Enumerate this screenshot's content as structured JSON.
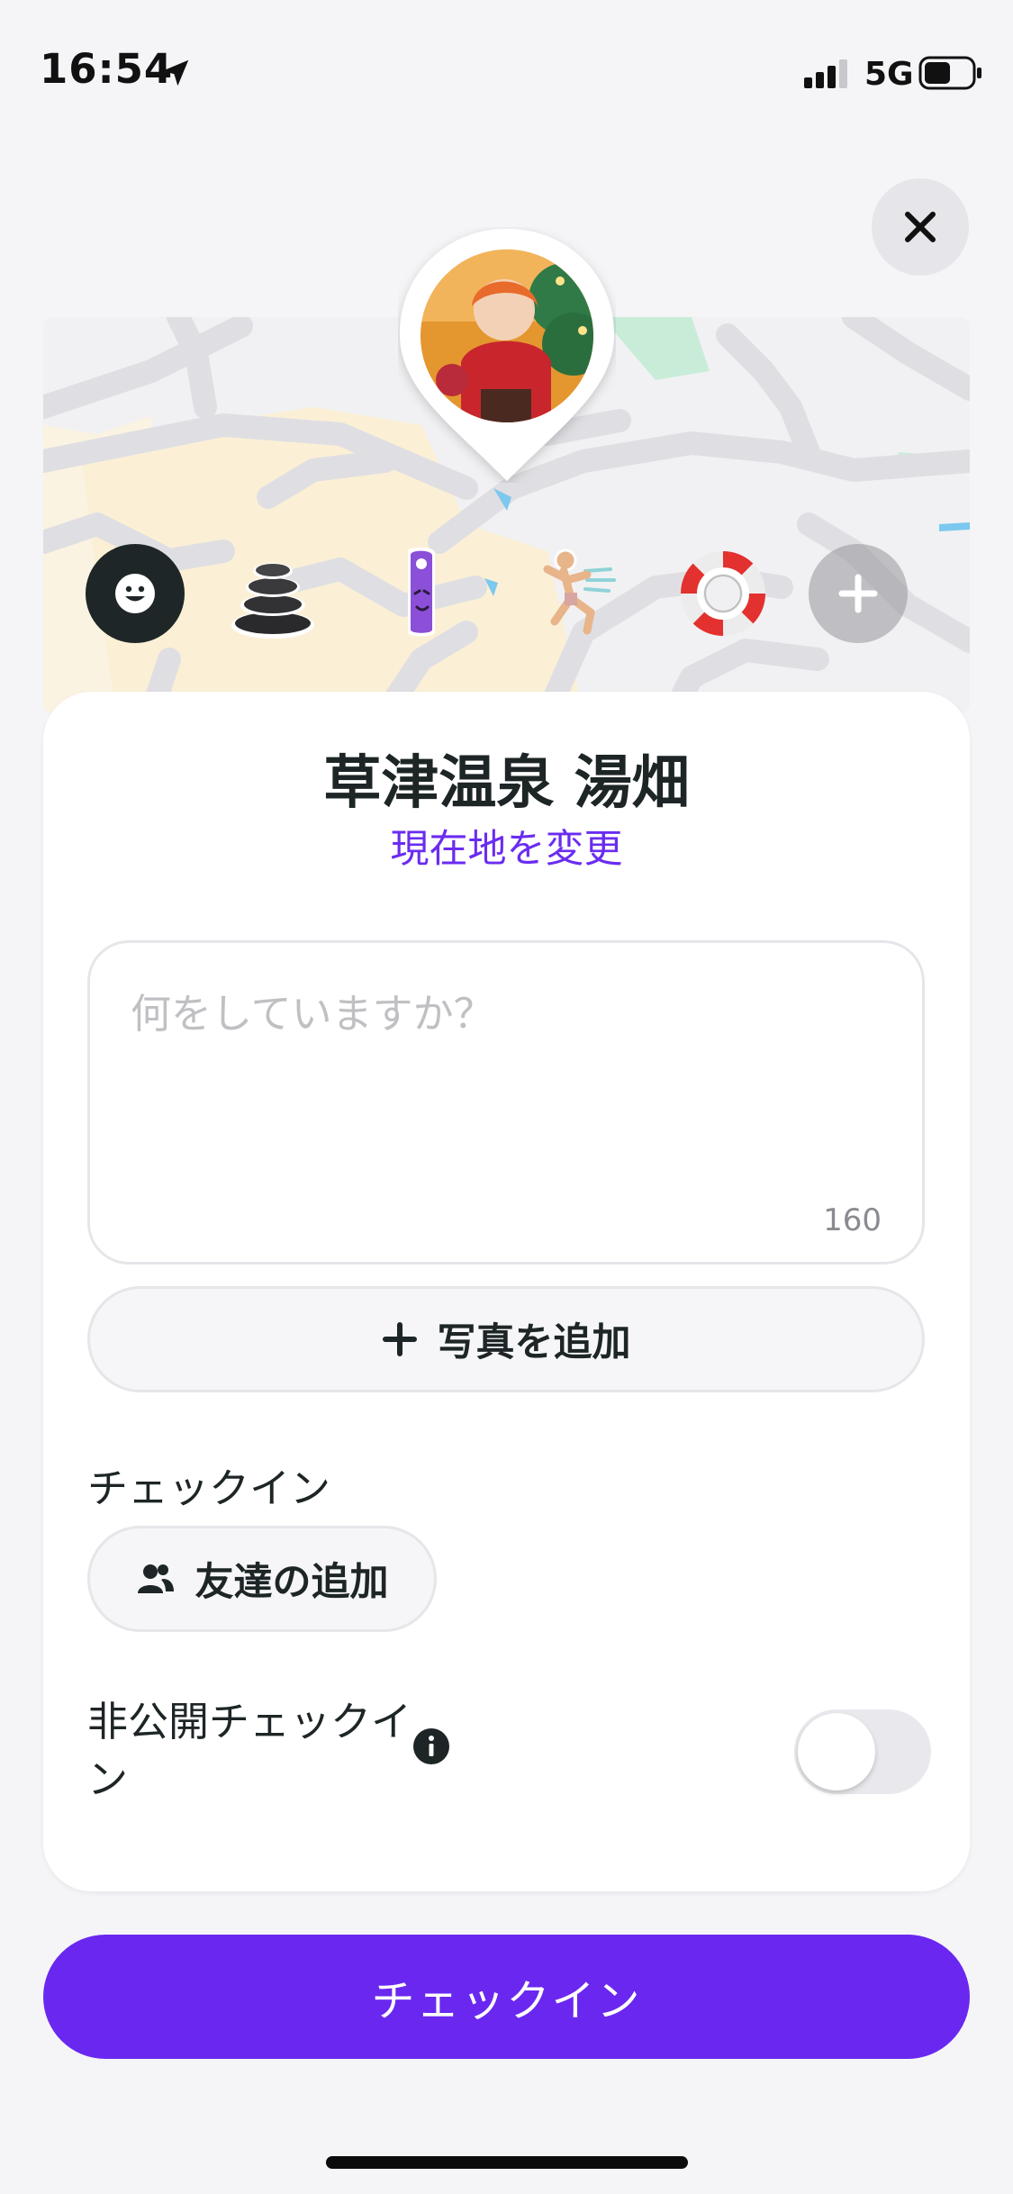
{
  "status_bar": {
    "time": "16:54",
    "network": "5G",
    "battery_level": 0.55
  },
  "map": {
    "avatar_icon": "avatar-image"
  },
  "stickers": [
    {
      "name": "smiley-icon",
      "selected": true
    },
    {
      "name": "stacked-stones-icon"
    },
    {
      "name": "door-hanger-icon"
    },
    {
      "name": "running-figure-icon"
    },
    {
      "name": "lifebuoy-icon"
    },
    {
      "name": "plus-icon"
    }
  ],
  "card": {
    "place_name": "草津温泉 湯畑",
    "change_location": "現在地を変更",
    "status_placeholder": "何をしていますか？",
    "char_count": "160",
    "add_photo": "写真を追加",
    "checkin_section": "チェックイン",
    "add_friends": "友達の追加",
    "private_checkin": "非公開チェックイン",
    "private_toggle_on": false
  },
  "checkin_button": "チェックイン",
  "colors": {
    "accent": "#6a27f0",
    "dark": "#1e2526",
    "background": "#f5f5f8"
  }
}
